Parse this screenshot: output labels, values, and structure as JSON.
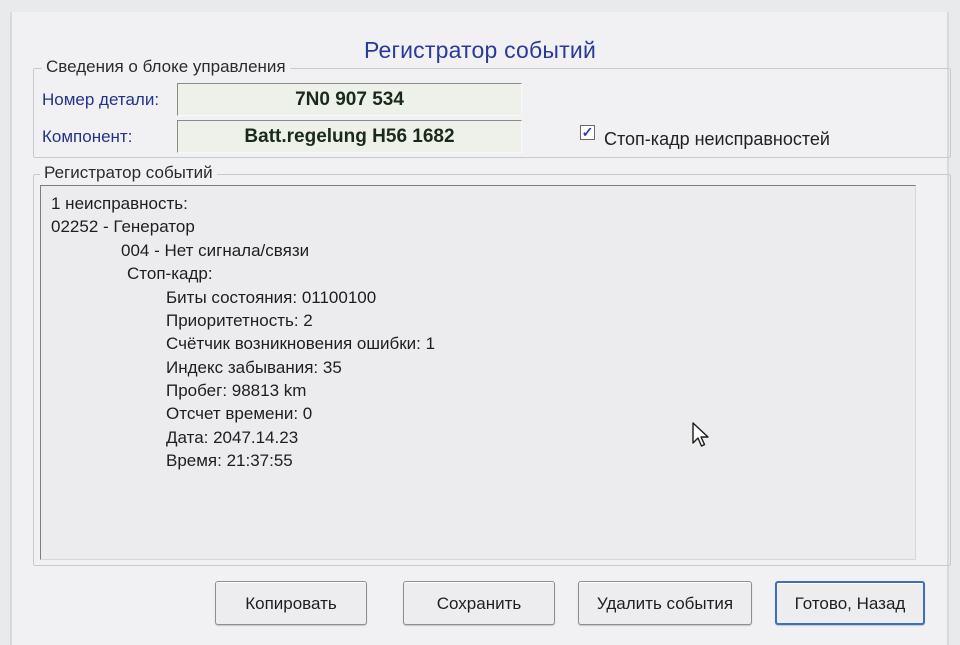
{
  "window": {
    "title": "Регистратор событий"
  },
  "control_unit": {
    "group_label": "Сведения о блоке управления",
    "part_number_label": "Номер детали:",
    "part_number_value": "7N0 907 534",
    "component_label": "Компонент:",
    "component_value": "Batt.regelung H56 1682"
  },
  "freeze_frame_checkbox": {
    "label": "Стоп-кадр неисправностей",
    "checked": true
  },
  "event_log": {
    "group_label": "Регистратор событий",
    "lines": [
      "1 неисправность:",
      "02252 - Генератор",
      "004 - Нет сигнала/связи",
      "Стоп-кадр:",
      "Биты состояния: 01100100",
      "Приоритетность: 2",
      "Счётчик возникновения ошибки: 1",
      "Индекс забывания: 35",
      "Пробег: 98813 km",
      "Отсчет времени: 0",
      "Дата: 2047.14.23",
      "Время: 21:37:55"
    ]
  },
  "buttons": {
    "copy": "Копировать",
    "save": "Сохранить",
    "delete_events": "Удалить события",
    "done_back": "Готово, Назад"
  },
  "colors": {
    "title": "#2a3a9a",
    "field_label": "#22338a",
    "default_button_border": "#3f6fb8"
  }
}
